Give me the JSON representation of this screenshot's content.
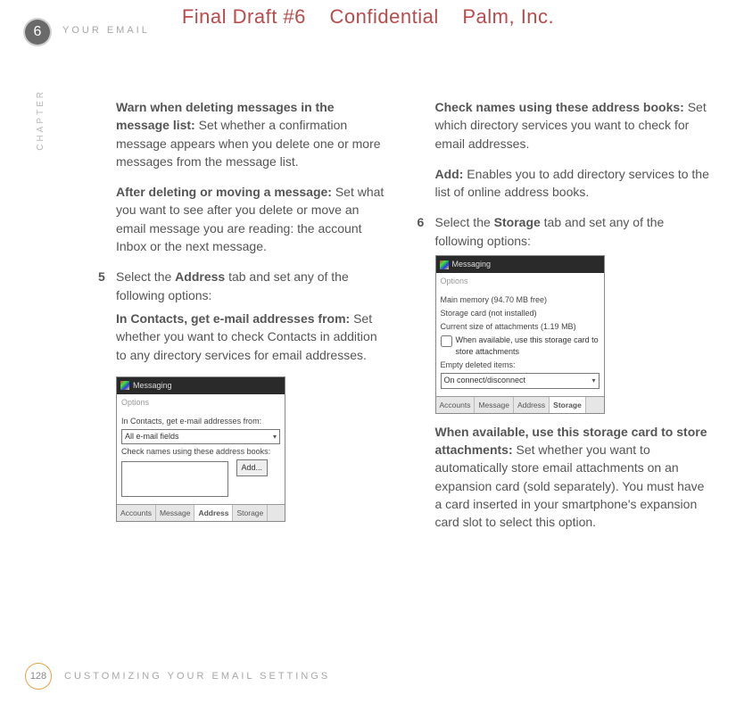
{
  "watermark": {
    "a": "Final Draft #6",
    "b": "Confidential",
    "c": "Palm, Inc."
  },
  "chapter_num": "6",
  "header": "YOUR EMAIL",
  "side": "CHAPTER",
  "page_num": "128",
  "footer": "CUSTOMIZING YOUR EMAIL SETTINGS",
  "left": {
    "p1": {
      "bold": "Warn when deleting messages in the message list:",
      "rest": " Set whether a confirmation message appears when you delete one or more messages from the message list."
    },
    "p2": {
      "bold": "After deleting or moving a message:",
      "rest": " Set what you want to see after you delete or move an email message you are reading: the account Inbox or the next message."
    },
    "step5": {
      "num": "5",
      "pre": "Select the ",
      "bold": "Address",
      "post": " tab and set any of the following options:"
    },
    "p3": {
      "bold": "In Contacts, get e-mail addresses from:",
      "rest": " Set whether you want to check Contacts in addition to any directory services for email addresses."
    }
  },
  "right": {
    "p1": {
      "bold": "Check names using these address books:",
      "rest": " Set which directory services you want to check for email addresses."
    },
    "p2": {
      "bold": "Add:",
      "rest": " Enables you to add directory services to the list of online address books."
    },
    "step6": {
      "num": "6",
      "pre": "Select the ",
      "bold": "Storage",
      "post": " tab and set any of the following options:"
    },
    "p3": {
      "bold": "When available, use this storage card to store attachments:",
      "rest": " Set whether you want to automatically store email attachments on an expansion card (sold separately). You must have a card inserted in your smartphone's expansion card slot to select this option."
    }
  },
  "shot1": {
    "title": "Messaging",
    "sub": "Options",
    "l1": "In Contacts, get e-mail addresses from:",
    "combo": "All e-mail fields",
    "l2": "Check names using these address books:",
    "add": "Add...",
    "tabs": [
      "Accounts",
      "Message",
      "Address",
      "Storage"
    ],
    "active_tab": 2
  },
  "shot2": {
    "title": "Messaging",
    "sub": "Options",
    "l1": "Main memory (94.70 MB free)",
    "l2": "Storage card (not installed)",
    "l3": "Current size of attachments (1.19 MB)",
    "chk": "When available, use this storage card to store attachments",
    "l4": "Empty deleted items:",
    "combo": "On connect/disconnect",
    "tabs": [
      "Accounts",
      "Message",
      "Address",
      "Storage"
    ],
    "active_tab": 3
  }
}
